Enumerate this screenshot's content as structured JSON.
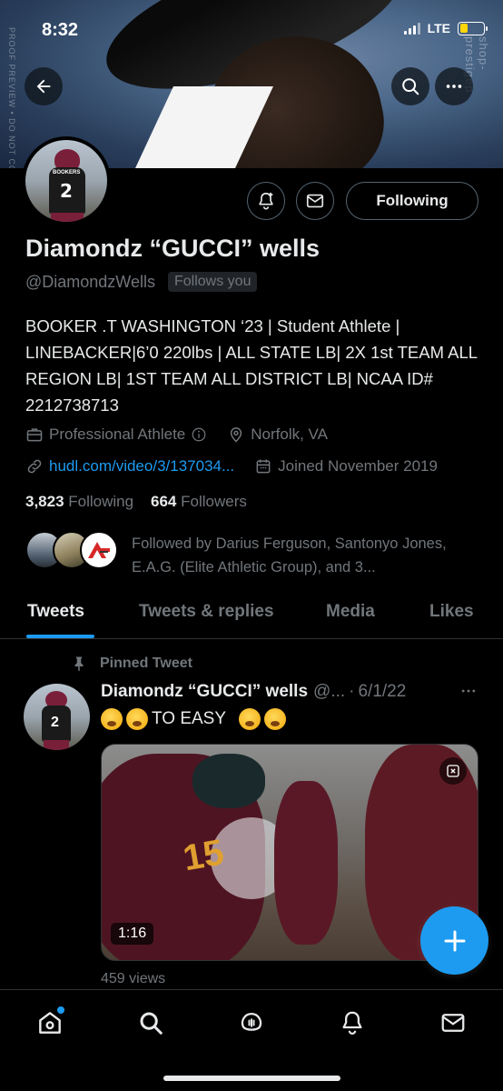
{
  "status_bar": {
    "time": "8:32",
    "network": "LTE"
  },
  "banner": {
    "watermark_left": "PROOF PREVIEW • DO NOT COP",
    "watermark_right": "shop-prestigep"
  },
  "profile": {
    "avatar_team": "BOOKERS",
    "avatar_number": "2",
    "follow_button_label": "Following",
    "name": "Diamondz “GUCCI” wells",
    "handle": "@DiamondzWells",
    "follows_you": "Follows you",
    "bio": "BOOKER .T WASHINGTON ‘23 | Student Athlete | LINEBACKER|6’0 220lbs | ALL STATE LB| 2X 1st TEAM ALL REGION LB| 1ST TEAM ALL DISTRICT LB| NCAA ID# 2212738713",
    "category": "Professional Athlete",
    "location": "Norfolk, VA",
    "website": "hudl.com/video/3/137034...",
    "joined": "Joined November 2019",
    "following_count": "3,823",
    "following_label": "Following",
    "followers_count": "664",
    "followers_label": "Followers",
    "followed_by": "Followed by Darius Ferguson, Santonyo Jones, E.A.G. (Elite Athletic Group), and 3..."
  },
  "tabs": [
    {
      "label": "Tweets",
      "active": true
    },
    {
      "label": "Tweets & replies",
      "active": false
    },
    {
      "label": "Media",
      "active": false
    },
    {
      "label": "Likes",
      "active": false
    }
  ],
  "pinned_tweet": {
    "pinned_label": "Pinned Tweet",
    "author_name": "Diamondz “GUCCI” wells",
    "author_handle": "@...",
    "date": "6/1/22",
    "text": "TO EASY",
    "video_duration": "1:16",
    "video_jersey_number": "15",
    "views": "459 views"
  },
  "colors": {
    "accent": "#1d9bf0",
    "background": "#000000",
    "muted": "#71767b",
    "text": "#e7e9ea"
  },
  "icons": [
    "back-arrow-icon",
    "search-icon",
    "more-icon",
    "bell-plus-icon",
    "mail-icon",
    "briefcase-icon",
    "info-icon",
    "location-pin-icon",
    "link-icon",
    "calendar-icon",
    "pin-icon",
    "video-share-icon",
    "compose-plus-icon",
    "home-icon",
    "explore-search-icon",
    "spaces-icon",
    "notifications-icon",
    "messages-icon"
  ]
}
